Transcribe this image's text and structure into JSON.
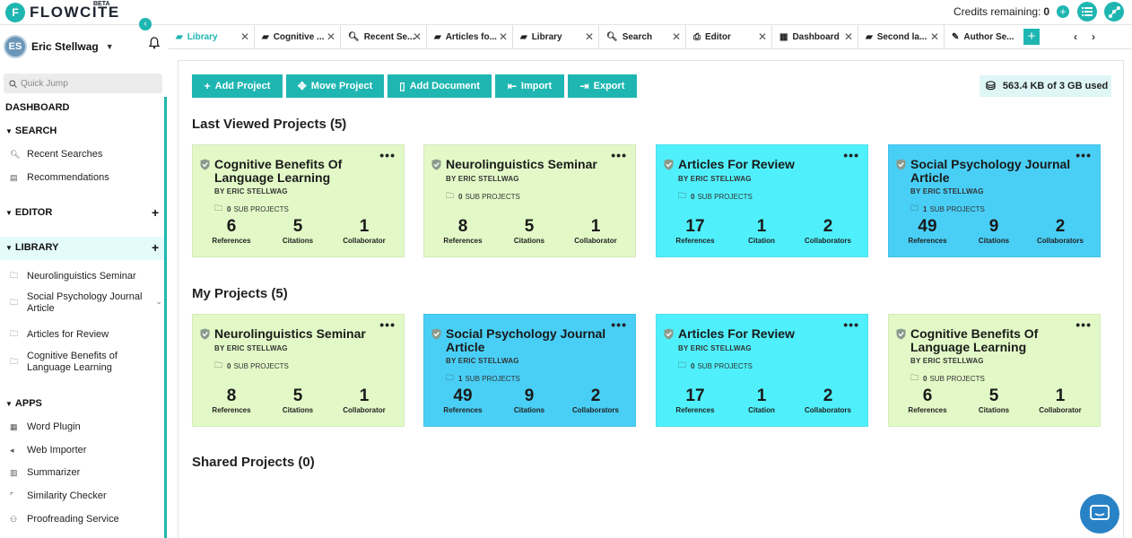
{
  "app": {
    "logo_mark": "F",
    "logo_text": "FLOWCITE",
    "beta": "BETA",
    "brand_color": "#1fb6b2"
  },
  "topbar": {
    "credits_label": "Credits remaining:",
    "credits_value": "0",
    "icons": [
      "plus-circle-icon",
      "list-icon",
      "graph-icon"
    ]
  },
  "user": {
    "initials": "ES",
    "name": "Eric Stellwag"
  },
  "sidebar": {
    "collapse_icon": "chevron-left-icon",
    "quick_jump_placeholder": "Quick Jump",
    "dashboard": "DASHBOARD",
    "search": {
      "title": "SEARCH",
      "items": [
        {
          "label": "Recent Searches",
          "icon": "search-icon"
        },
        {
          "label": "Recommendations",
          "icon": "doc-icon"
        }
      ]
    },
    "editor": {
      "title": "EDITOR"
    },
    "library": {
      "title": "LIBRARY",
      "items": [
        {
          "label": "Neurolinguistics Seminar",
          "icon": "folder-icon"
        },
        {
          "label": "Social Psychology Journal Article",
          "icon": "folder-icon"
        },
        {
          "label": "Articles for Review",
          "icon": "folder-icon"
        },
        {
          "label": "Cognitive Benefits of Language Learning",
          "icon": "folder-icon"
        }
      ]
    },
    "apps": {
      "title": "APPS",
      "items": [
        {
          "label": "Word Plugin",
          "icon": "word-icon"
        },
        {
          "label": "Web Importer",
          "icon": "import-icon"
        },
        {
          "label": "Summarizer",
          "icon": "books-icon"
        },
        {
          "label": "Similarity Checker",
          "icon": "check-icon"
        },
        {
          "label": "Proofreading Service",
          "icon": "person-icon"
        }
      ]
    }
  },
  "tabs": [
    {
      "label": "Library",
      "icon": "folder-icon",
      "active": true
    },
    {
      "label": "Cognitive ...",
      "icon": "folder-icon"
    },
    {
      "label": "Recent Se...",
      "icon": "search-history-icon"
    },
    {
      "label": "Articles fo...",
      "icon": "folder-icon"
    },
    {
      "label": "Library",
      "icon": "folder-icon"
    },
    {
      "label": "Search",
      "icon": "search-icon"
    },
    {
      "label": "Editor",
      "icon": "printer-icon"
    },
    {
      "label": "Dashboard",
      "icon": "dashboard-icon"
    },
    {
      "label": "Second la...",
      "icon": "folder-icon"
    },
    {
      "label": "Author Se...",
      "icon": "author-icon"
    }
  ],
  "toolbar": {
    "add_project": "Add Project",
    "move_project": "Move Project",
    "add_document": "Add Document",
    "import": "Import",
    "export": "Export"
  },
  "storage": {
    "label": "563.4 KB of 3 GB used"
  },
  "sections": {
    "last_viewed": {
      "title": "Last Viewed Projects (5)"
    },
    "my_projects": {
      "title": "My Projects (5)"
    },
    "shared": {
      "title": "Shared Projects (0)"
    }
  },
  "colors": {
    "green_card": "#e2f9c7",
    "cyan_card": "#4ff0fb",
    "blue_card": "#49cff6"
  },
  "last_viewed_cards": [
    {
      "name": "Cognitive Benefits Of Language Learning",
      "author": "BY ERIC STELLWAG",
      "sub_count": "0",
      "sub_label": "SUB PROJECTS",
      "references": "6",
      "references_label": "References",
      "citations": "5",
      "citations_label": "Citations",
      "collaborators": "1",
      "collaborators_label": "Collaborator",
      "color": "#e2f9c7",
      "two_line": true
    },
    {
      "name": "Neurolinguistics Seminar",
      "author": "BY ERIC STELLWAG",
      "sub_count": "0",
      "sub_label": "SUB PROJECTS",
      "references": "8",
      "references_label": "References",
      "citations": "5",
      "citations_label": "Citations",
      "collaborators": "1",
      "collaborators_label": "Collaborator",
      "color": "#e2f9c7",
      "two_line": false
    },
    {
      "name": "Articles For Review",
      "author": "BY ERIC STELLWAG",
      "sub_count": "0",
      "sub_label": "SUB PROJECTS",
      "references": "17",
      "references_label": "References",
      "citations": "1",
      "citations_label": "Citation",
      "collaborators": "2",
      "collaborators_label": "Collaborators",
      "color": "#4ff0fb",
      "two_line": false
    },
    {
      "name": "Social Psychology Journal Article",
      "author": "BY ERIC STELLWAG",
      "sub_count": "1",
      "sub_label": "SUB PROJECTS",
      "references": "49",
      "references_label": "References",
      "citations": "9",
      "citations_label": "Citations",
      "collaborators": "2",
      "collaborators_label": "Collaborators",
      "color": "#49cff6",
      "two_line": true
    }
  ],
  "my_project_cards": [
    {
      "name": "Neurolinguistics Seminar",
      "author": "BY ERIC STELLWAG",
      "sub_count": "0",
      "sub_label": "SUB PROJECTS",
      "references": "8",
      "references_label": "References",
      "citations": "5",
      "citations_label": "Citations",
      "collaborators": "1",
      "collaborators_label": "Collaborator",
      "color": "#e2f9c7",
      "two_line": false
    },
    {
      "name": "Social Psychology Journal Article",
      "author": "BY ERIC STELLWAG",
      "sub_count": "1",
      "sub_label": "SUB PROJECTS",
      "references": "49",
      "references_label": "References",
      "citations": "9",
      "citations_label": "Citations",
      "collaborators": "2",
      "collaborators_label": "Collaborators",
      "color": "#49cff6",
      "two_line": true
    },
    {
      "name": "Articles For Review",
      "author": "BY ERIC STELLWAG",
      "sub_count": "0",
      "sub_label": "SUB PROJECTS",
      "references": "17",
      "references_label": "References",
      "citations": "1",
      "citations_label": "Citation",
      "collaborators": "2",
      "collaborators_label": "Collaborators",
      "color": "#4ff0fb",
      "two_line": false
    },
    {
      "name": "Cognitive Benefits Of Language Learning",
      "author": "BY ERIC STELLWAG",
      "sub_count": "0",
      "sub_label": "SUB PROJECTS",
      "references": "6",
      "references_label": "References",
      "citations": "5",
      "citations_label": "Citations",
      "collaborators": "1",
      "collaborators_label": "Collaborator",
      "color": "#e2f9c7",
      "two_line": true
    }
  ],
  "chat": {
    "icon": "chat-icon"
  }
}
